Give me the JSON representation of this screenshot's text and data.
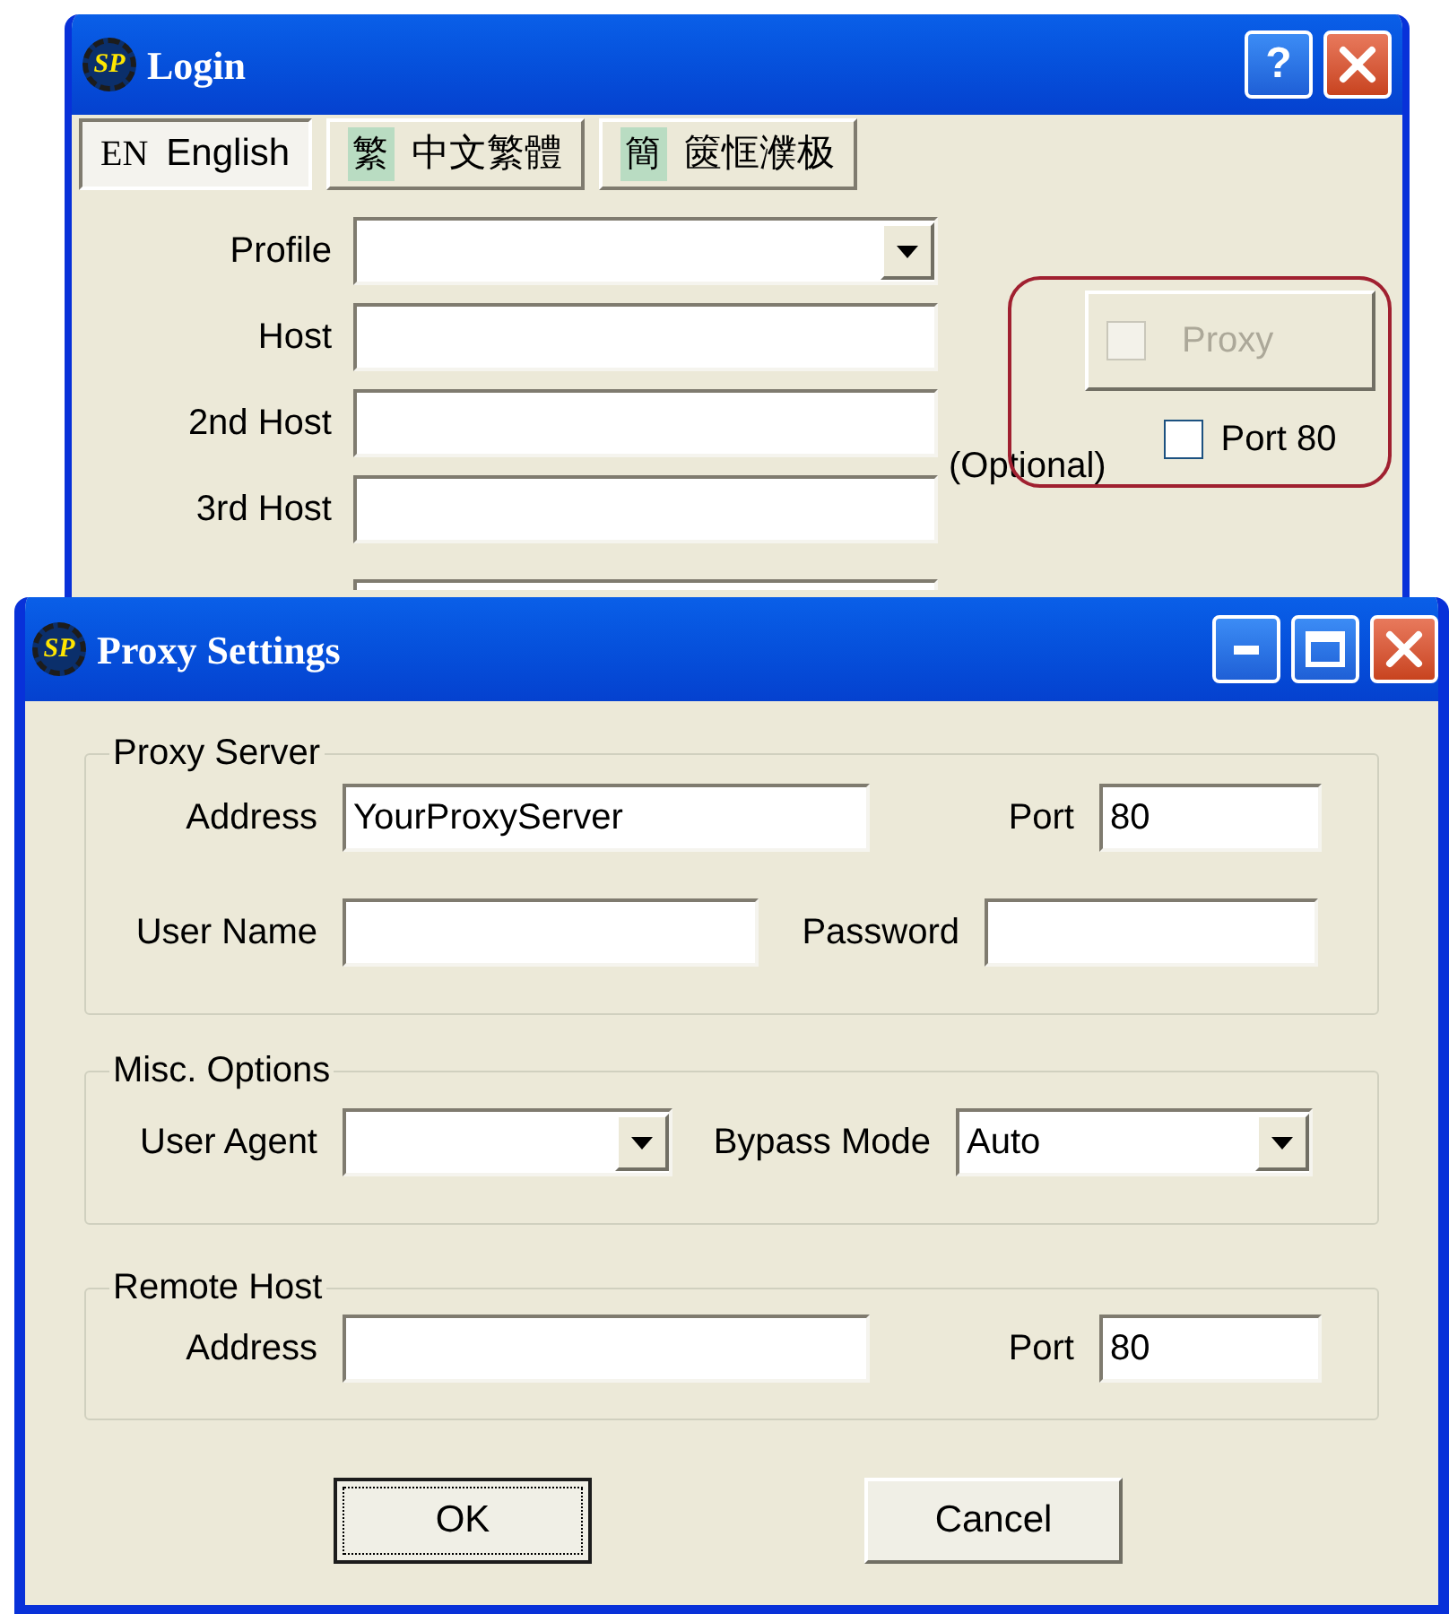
{
  "login_window": {
    "logo": "SP",
    "title": "Login",
    "help_button": "?",
    "language_tabs": [
      {
        "code": "EN",
        "label": "English",
        "selected": true
      },
      {
        "code": "繁",
        "label": "中文繁體",
        "selected": false
      },
      {
        "code": "簡",
        "label": "篋恇濮极",
        "selected": false
      }
    ],
    "fields": [
      {
        "label": "Profile",
        "kind": "dropdown"
      },
      {
        "label": "Host",
        "kind": "text"
      },
      {
        "label": "2nd Host",
        "kind": "text"
      },
      {
        "label": "3rd Host",
        "kind": "text"
      }
    ],
    "optional_note": "(Optional)",
    "proxy_toggle": {
      "label": "Proxy",
      "checked": false,
      "disabled": true
    },
    "port80": {
      "label": "Port 80",
      "checked": false
    }
  },
  "proxy_window": {
    "logo": "SP",
    "title": "Proxy Settings",
    "proxy_server": {
      "title": "Proxy Server",
      "address": {
        "label": "Address",
        "value": "YourProxyServer"
      },
      "port": {
        "label": "Port",
        "value": "80"
      },
      "user_name": {
        "label": "User Name"
      },
      "password": {
        "label": "Password"
      }
    },
    "misc_options": {
      "title": "Misc. Options",
      "user_agent": {
        "label": "User Agent"
      },
      "bypass_mode": {
        "label": "Bypass Mode",
        "value": "Auto"
      }
    },
    "remote_host": {
      "title": "Remote Host",
      "address": {
        "label": "Address"
      },
      "port": {
        "label": "Port",
        "value": "80"
      }
    },
    "buttons": [
      {
        "label": "OK",
        "focused": true
      },
      {
        "label": "Cancel",
        "focused": false
      }
    ]
  }
}
